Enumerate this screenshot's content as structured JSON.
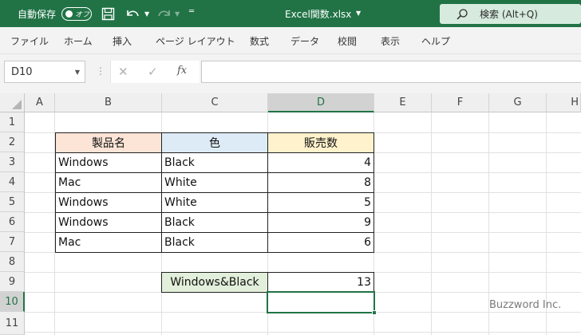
{
  "titlebar": {
    "autosave_label": "自動保存",
    "autosave_state": "オフ",
    "filename": "Excel関数.xlsx",
    "search_placeholder": "検索 (Alt+Q)",
    "accent": "#217346"
  },
  "menu": [
    "ファイル",
    "ホーム",
    "挿入",
    "ページ レイアウト",
    "数式",
    "データ",
    "校閲",
    "表示",
    "ヘルプ"
  ],
  "formula_bar": {
    "name_box": "D10",
    "fx_label": "fx",
    "formula": ""
  },
  "sheet": {
    "columns": [
      "A",
      "B",
      "C",
      "D",
      "E",
      "F",
      "G",
      "H"
    ],
    "rows": [
      "1",
      "2",
      "3",
      "4",
      "5",
      "6",
      "7",
      "8",
      "9",
      "10",
      "11"
    ],
    "active_cell": "D10",
    "headers": {
      "product": "製品名",
      "color": "色",
      "sales": "販売数"
    },
    "data": [
      {
        "product": "Windows",
        "color": "Black",
        "sales": "4"
      },
      {
        "product": "Mac",
        "color": "White",
        "sales": "8"
      },
      {
        "product": "Windows",
        "color": "White",
        "sales": "5"
      },
      {
        "product": "Windows",
        "color": "Black",
        "sales": "9"
      },
      {
        "product": "Mac",
        "color": "Black",
        "sales": "6"
      }
    ],
    "criteria_label": "Windows&Black",
    "criteria_result": "13"
  },
  "watermark": "Buzzword Inc."
}
